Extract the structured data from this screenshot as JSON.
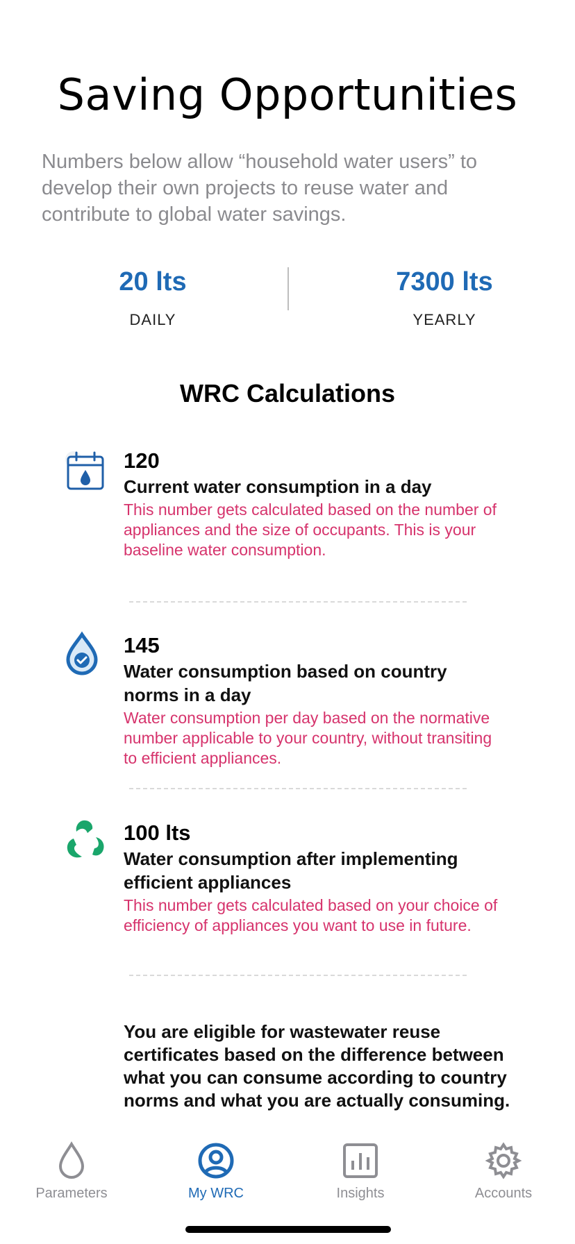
{
  "page": {
    "title": "Saving Opportunities",
    "subtitle": "Numbers below allow “household water users” to develop their own projects to reuse water and contribute to global water savings."
  },
  "savings": {
    "daily": {
      "value": "20 lts",
      "label": "DAILY"
    },
    "yearly": {
      "value": "7300 lts",
      "label": "YEARLY"
    }
  },
  "wrc": {
    "title": "WRC Calculations",
    "items": [
      {
        "icon": "calendar-drop-icon",
        "value": "120",
        "heading": "Current water consumption in a day",
        "description": "This number gets calculated based on the number of appliances and the size of occupants. This is your baseline water consumption."
      },
      {
        "icon": "drop-check-icon",
        "value": "145",
        "heading": "Water consumption based on country norms in a day",
        "description": "Water consumption per day based on the normative number applicable to your country, without transiting to efficient appliances."
      },
      {
        "icon": "recycle-icon",
        "value": "100 lts",
        "heading": "Water consumption after implementing efficient appliances",
        "description": "This number gets calculated based on your choice of efficiency of appliances you want to use in future."
      }
    ],
    "eligibility": "You are eligible for wastewater reuse certificates based on the difference between what you can consume according to country norms and what you are actually consuming."
  },
  "tabbar": {
    "tabs": [
      {
        "label": "Parameters",
        "icon": "water-drop-icon",
        "active": false
      },
      {
        "label": "My WRC",
        "icon": "user-circle-icon",
        "active": true
      },
      {
        "label": "Insights",
        "icon": "bar-chart-icon",
        "active": false
      },
      {
        "label": "Accounts",
        "icon": "gear-icon",
        "active": false
      }
    ]
  },
  "colors": {
    "accent": "#1f6ab5",
    "description": "#d6336c",
    "inactive": "#8e8e93",
    "recycle": "#1aa66b"
  }
}
